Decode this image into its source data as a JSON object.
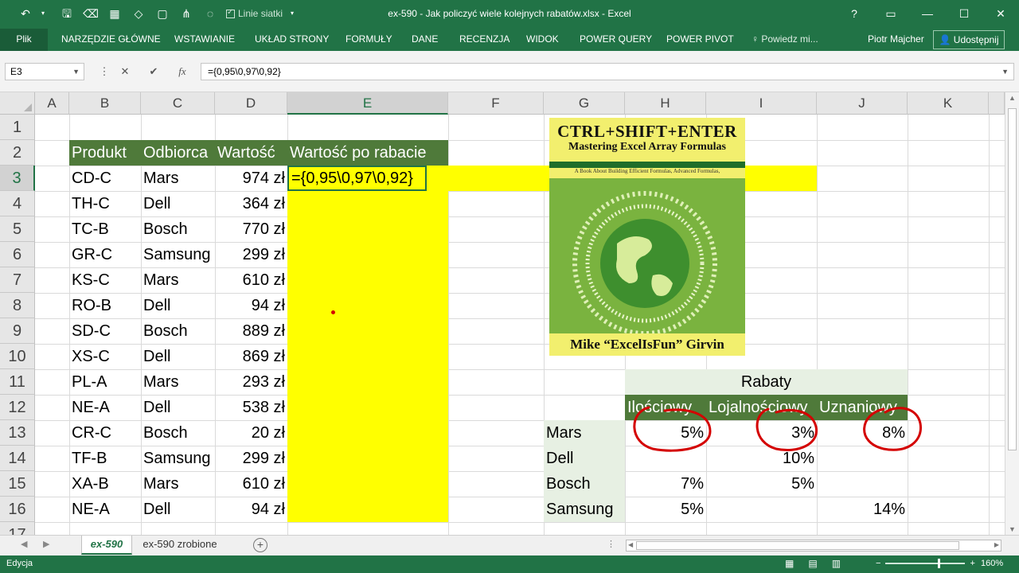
{
  "window": {
    "title": "ex-590 - Jak policzyć wiele kolejnych rabatów.xlsx - Excel",
    "gridlines_label": "Linie siatki",
    "controls": [
      "?",
      "▭",
      "—",
      "☐",
      "✕"
    ]
  },
  "qat": {
    "undo_icon": "↶",
    "save_icon": "🖫",
    "eraser_icon": "⌫",
    "table_icon": "▦",
    "fill_icon": "◇",
    "borders_icon": "▢",
    "tree_icon": "⋔",
    "shapes_icon": "◌"
  },
  "ribbon": {
    "file": "Plik",
    "tabs": [
      "NARZĘDZIE GŁÓWNE",
      "WSTAWIANIE",
      "UKŁAD STRONY",
      "FORMUŁY",
      "DANE",
      "RECENZJA",
      "WIDOK",
      "POWER QUERY",
      "POWER PIVOT"
    ],
    "tell_me": "Powiedz mi...",
    "user": "Piotr Majcher",
    "share": "Udostępnij"
  },
  "formula_bar": {
    "name_box": "E3",
    "cancel": "✕",
    "enter": "✔",
    "fx": "fx",
    "formula": "={0,95\\0,97\\0,92}"
  },
  "columns": [
    "A",
    "B",
    "C",
    "D",
    "E",
    "F",
    "G",
    "H",
    "I",
    "J",
    "K"
  ],
  "rows": [
    "1",
    "2",
    "3",
    "4",
    "5",
    "6",
    "7",
    "8",
    "9",
    "10",
    "11",
    "12",
    "13",
    "14",
    "15",
    "16",
    "17"
  ],
  "table": {
    "headers": [
      "Produkt",
      "Odbiorca",
      "Wartość",
      "Wartość po rabacie"
    ],
    "rows": [
      [
        "CD-C",
        "Mars",
        "974 zł"
      ],
      [
        "TH-C",
        "Dell",
        "364 zł"
      ],
      [
        "TC-B",
        "Bosch",
        "770 zł"
      ],
      [
        "GR-C",
        "Samsung",
        "299 zł"
      ],
      [
        "KS-C",
        "Mars",
        "610 zł"
      ],
      [
        "RO-B",
        "Dell",
        "94 zł"
      ],
      [
        "SD-C",
        "Bosch",
        "889 zł"
      ],
      [
        "XS-C",
        "Dell",
        "869 zł"
      ],
      [
        "PL-A",
        "Mars",
        "293 zł"
      ],
      [
        "NE-A",
        "Dell",
        "538 zł"
      ],
      [
        "CR-C",
        "Bosch",
        "20 zł"
      ],
      [
        "TF-B",
        "Samsung",
        "299 zł"
      ],
      [
        "XA-B",
        "Mars",
        "610 zł"
      ],
      [
        "NE-A",
        "Dell",
        "94 zł"
      ]
    ],
    "editing_formula": "={0,95\\0,97\\0,92}"
  },
  "discounts": {
    "title": "Rabaty",
    "headers": [
      "Ilościowy",
      "Lojalnościowy",
      "Uznaniowy"
    ],
    "rows": [
      {
        "name": "Mars",
        "values": [
          "5%",
          "3%",
          "8%"
        ]
      },
      {
        "name": "Dell",
        "values": [
          "",
          "10%",
          ""
        ]
      },
      {
        "name": "Bosch",
        "values": [
          "7%",
          "5%",
          ""
        ]
      },
      {
        "name": "Samsung",
        "values": [
          "5%",
          "",
          "14%"
        ]
      }
    ]
  },
  "book": {
    "title_line1": "CTRL+SHIFT+ENTER",
    "title_line2": "Mastering Excel Array Formulas",
    "subtitle": "A Book About Building Efficient Formulas, Advanced Formulas,",
    "author": "Mike “ExcelIsFun” Girvin"
  },
  "sheets": [
    "ex-590",
    "ex-590 zrobione"
  ],
  "status": {
    "mode": "Edycja",
    "zoom": "160%"
  },
  "colors": {
    "excel_green": "#217346",
    "header_green": "#4f7a3a",
    "label_green": "#e7f0e3",
    "highlight_yellow": "#ffff00",
    "annotation_red": "#d40000"
  }
}
